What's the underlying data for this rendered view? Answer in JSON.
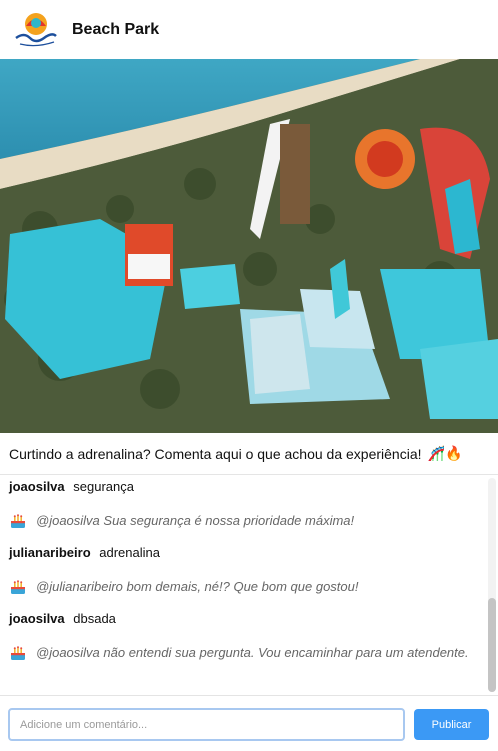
{
  "header": {
    "title": "Beach Park",
    "logo_icon": "beach-park-logo"
  },
  "post": {
    "image_icon": "water-park-aerial-photo",
    "caption": "Curtindo a adrenalina? Comenta aqui o que achou da experiência!",
    "caption_emoji": "🎢🔥"
  },
  "comments": [
    {
      "type": "comment",
      "user": "joaosilva",
      "text": "segurança"
    },
    {
      "type": "reply",
      "avatar_icon": "cake-avatar-icon",
      "text": "@joaosilva Sua segurança é nossa prioridade máxima!"
    },
    {
      "type": "comment",
      "user": "julianaribeiro",
      "text": "adrenalina"
    },
    {
      "type": "reply",
      "avatar_icon": "cake-avatar-icon",
      "text": "@julianaribeiro bom demais, né!? Que bom que gostou!"
    },
    {
      "type": "comment",
      "user": "joaosilva",
      "text": "dbsada"
    },
    {
      "type": "reply",
      "avatar_icon": "cake-avatar-icon",
      "text": "@joaosilva não entendi sua pergunta. Vou encaminhar para um atendente."
    }
  ],
  "footer": {
    "input_placeholder": "Adicione um comentário...",
    "input_value": "",
    "publish_label": "Publicar"
  },
  "colors": {
    "accent": "#3b99f5",
    "input_border": "#a8c8f0",
    "reply_text": "#666666"
  }
}
